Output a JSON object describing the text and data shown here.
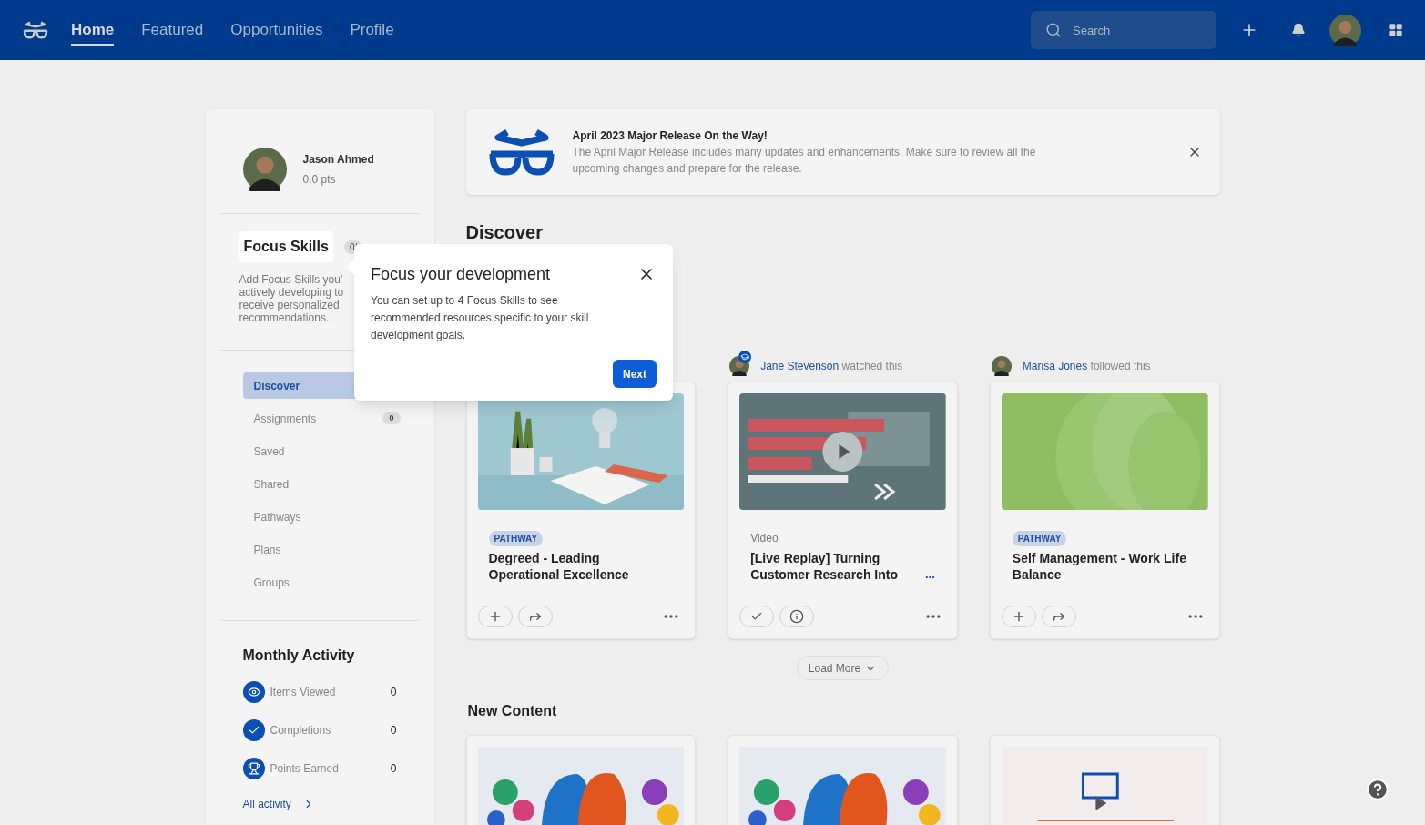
{
  "nav": {
    "items": [
      {
        "label": "Home",
        "selected": true
      },
      {
        "label": "Featured",
        "selected": false
      },
      {
        "label": "Opportunities",
        "selected": false
      },
      {
        "label": "Profile",
        "selected": false
      }
    ],
    "search": {
      "placeholder": "Search"
    }
  },
  "profile": {
    "name": "Jason Ahmed",
    "points": "0.0 pts"
  },
  "focus_skills": {
    "title": "Focus Skills",
    "count": "0/",
    "description_lines": [
      "Add Focus Skills you'",
      "actively developing to",
      "receive personalized",
      "recommendations."
    ]
  },
  "sidebar_nav": [
    {
      "label": "Discover",
      "selected": true
    },
    {
      "label": "Assignments",
      "selected": false,
      "badge": "0"
    },
    {
      "label": "Saved",
      "selected": false
    },
    {
      "label": "Shared",
      "selected": false
    },
    {
      "label": "Pathways",
      "selected": false
    },
    {
      "label": "Plans",
      "selected": false
    },
    {
      "label": "Groups",
      "selected": false
    }
  ],
  "monthly_activity": {
    "title": "Monthly Activity",
    "items": [
      {
        "kind": "eye",
        "label": "Items Viewed",
        "value": "0"
      },
      {
        "kind": "check",
        "label": "Completions",
        "value": "0"
      },
      {
        "kind": "trophy",
        "label": "Points Earned",
        "value": "0"
      }
    ],
    "link": "All activity"
  },
  "banner": {
    "title": "April 2023 Major Release On the Way!",
    "text": "The April Major Release includes many updates and enhancements. Make sure to review all the upcoming changes and prepare for the release."
  },
  "discover": {
    "title": "Discover",
    "cards": [
      {
        "type": {
          "kind": "badge",
          "label": "PATHWAY"
        },
        "title": "Degreed - Leading Operational Excellence",
        "actions": [
          {
            "kind": "add"
          },
          {
            "kind": "share"
          }
        ]
      },
      {
        "activity": {
          "user": "Jane Stevenson",
          "action": "watched this"
        },
        "type": {
          "kind": "text",
          "label": "Video"
        },
        "title": "[Live Replay] Turning Customer Research Into",
        "more": "...",
        "actions": [
          {
            "kind": "check"
          },
          {
            "kind": "info"
          }
        ]
      },
      {
        "activity": {
          "user": "Marisa Jones",
          "action": "followed this"
        },
        "type": {
          "kind": "badge",
          "label": "PATHWAY"
        },
        "title": "Self Management - Work Life Balance",
        "actions": [
          {
            "kind": "add"
          },
          {
            "kind": "share"
          }
        ]
      }
    ],
    "load_more": "Load More"
  },
  "new_content": {
    "title": "New Content"
  },
  "popover": {
    "title": "Focus your development",
    "text": "You can set up to 4 Focus Skills to see recommended resources specific to your skill development goals.",
    "button": "Next"
  }
}
